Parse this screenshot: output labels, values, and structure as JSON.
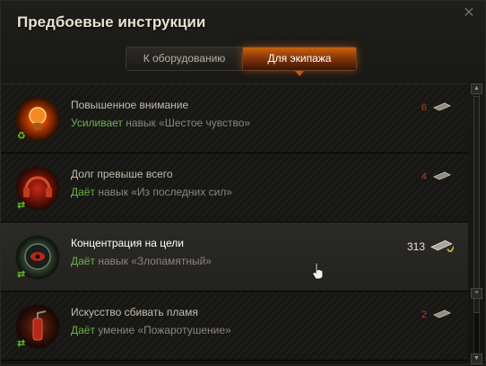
{
  "window": {
    "title": "Предбоевые инструкции",
    "close_icon": "close-icon"
  },
  "tabs": [
    {
      "label": "К оборудованию",
      "active": false
    },
    {
      "label": "Для экипажа",
      "active": true
    }
  ],
  "items": [
    {
      "name": "Повышенное внимание",
      "verb": "Усиливает",
      "desc": " навык «Шестое чувство»",
      "count": "6",
      "icon": "lightbulb-icon",
      "badge_icon": "recycle-icon",
      "hover": false
    },
    {
      "name": "Долг превыше всего",
      "verb": "Даёт",
      "desc": " навык «Из последних сил»",
      "count": "4",
      "icon": "headphones-icon",
      "badge_icon": "exchange-icon",
      "hover": false
    },
    {
      "name": "Концентрация на цели",
      "verb": "Даёт",
      "desc": " навык «Злопамятный»",
      "count": "313",
      "icon": "target-eye-icon",
      "badge_icon": "exchange-icon",
      "hover": true
    },
    {
      "name": "Искусство сбивать пламя",
      "verb": "Даёт",
      "desc": " умение «Пожаротушение»",
      "count": "2",
      "icon": "fire-extinguisher-icon",
      "badge_icon": "exchange-icon",
      "hover": false
    }
  ],
  "colors": {
    "accent": "#c9630e",
    "verb_green": "#6db34a",
    "count_red": "#b83a25"
  }
}
